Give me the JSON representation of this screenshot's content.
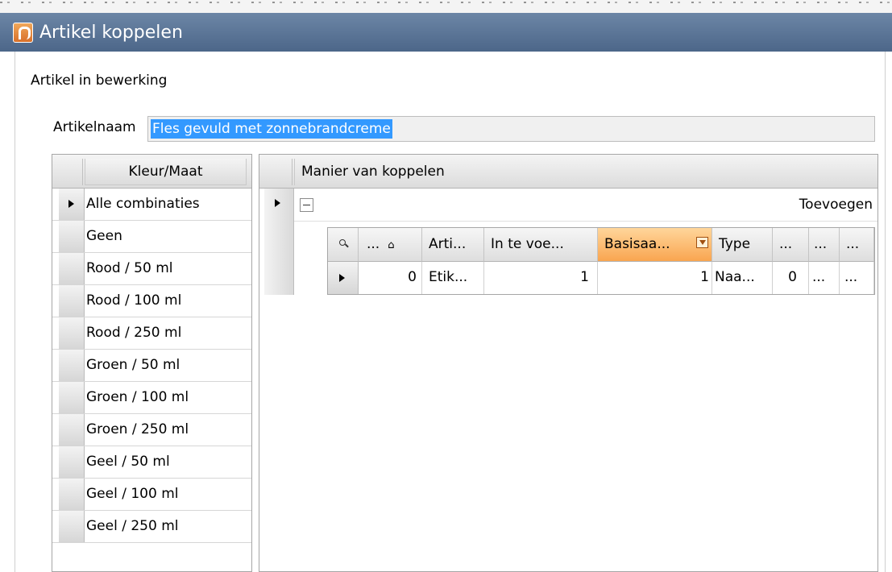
{
  "window": {
    "title": "Artikel koppelen",
    "icon": "app-logo-icon"
  },
  "group": {
    "title": "Artikel in bewerking"
  },
  "article": {
    "label": "Artikelnaam",
    "value": "Fles gevuld met zonnebrandcreme"
  },
  "left_grid": {
    "header": "Kleur/Maat",
    "rows": [
      "Alle combinaties",
      "Geen",
      "Rood / 50 ml",
      "Rood / 100 ml",
      "Rood / 250 ml",
      "Groen / 50 ml",
      "Groen / 100 ml",
      "Groen / 250 ml",
      "Geel / 50 ml",
      "Geel / 100 ml",
      "Geel / 250 ml"
    ]
  },
  "right_grid": {
    "header": "Manier van koppelen",
    "group_row": {
      "action": "Toevoegen"
    },
    "detail": {
      "headers": [
        "...",
        "Arti...",
        "In te voe...",
        "Basisaa...",
        "Type",
        "...",
        "...",
        "..."
      ],
      "row": [
        "0",
        "Etik...",
        "1",
        "1",
        "Naa...",
        "0",
        "...",
        "..."
      ]
    }
  }
}
